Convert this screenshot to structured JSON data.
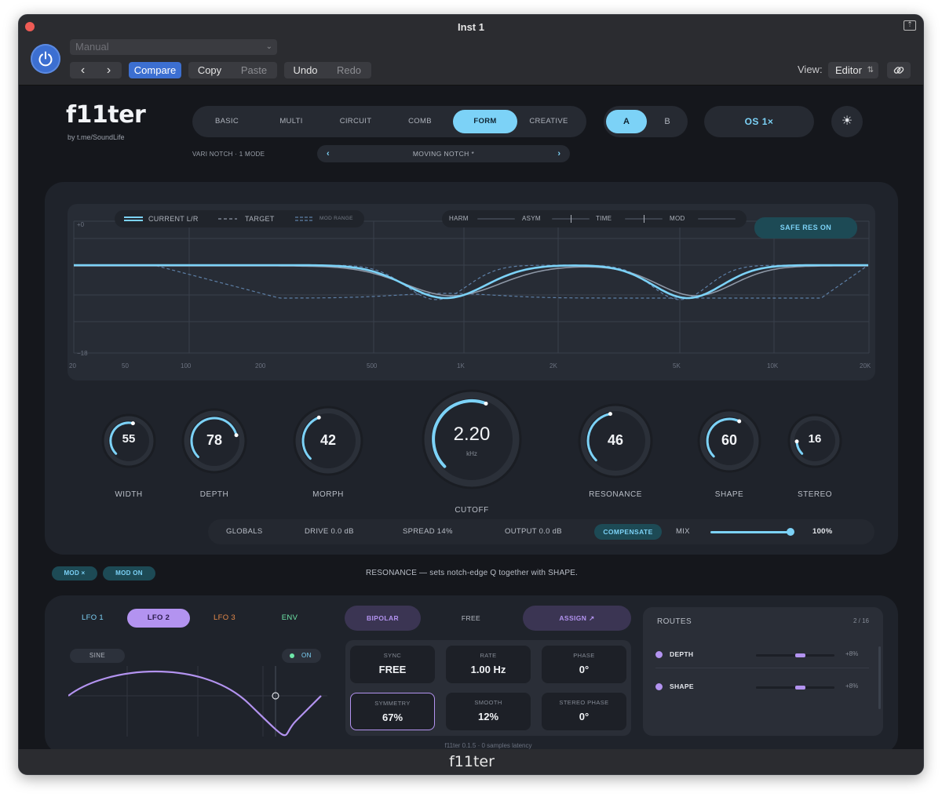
{
  "window": {
    "title": "Inst 1",
    "footer_title": "f11ter"
  },
  "toolbar": {
    "preset": "Manual",
    "prev_label": "‹",
    "next_label": "›",
    "compare": "Compare",
    "copy": "Copy",
    "paste": "Paste",
    "undo": "Undo",
    "redo": "Redo",
    "view_label": "View:",
    "view_value": "Editor"
  },
  "plugin": {
    "logo": "f11ter",
    "byline": "by t.me/SoundLife",
    "modes": [
      "BASIC",
      "MULTI",
      "CIRCUIT",
      "COMB",
      "FORM",
      "CREATIVE"
    ],
    "active_mode": "FORM",
    "ab": {
      "a": "A",
      "b": "B",
      "active": "A"
    },
    "os_label": "OS  1×",
    "sub_header": "VARI NOTCH  ·  1 MODE",
    "notch_preset": "MOVING NOTCH  *"
  },
  "graph": {
    "legend": {
      "current": "CURRENT L/R",
      "target": "TARGET",
      "mod_range": "MOD RANGE"
    },
    "params": {
      "harm": "HARM",
      "asym": "ASYM",
      "time": "TIME",
      "mod": "MOD"
    },
    "safe_res": "SAFE RES  ON",
    "db_top": "+0",
    "db_bottom": "−18",
    "freq_labels": [
      "20",
      "50",
      "100",
      "200",
      "500",
      "1K",
      "2K",
      "5K",
      "10K",
      "20K"
    ],
    "colors": {
      "current": "#7cd2f7",
      "target": "#6b8fb8",
      "grid": "#3a404b"
    }
  },
  "knobs": [
    {
      "id": "width",
      "value": "55",
      "label": "WIDTH",
      "fraction": 0.55
    },
    {
      "id": "depth",
      "value": "78",
      "label": "DEPTH",
      "fraction": 0.78
    },
    {
      "id": "morph",
      "value": "42",
      "label": "MORPH",
      "fraction": 0.42
    },
    {
      "id": "cutoff",
      "value": "2.20",
      "unit": "kHz",
      "label": "CUTOFF",
      "fraction": 0.58
    },
    {
      "id": "resonance",
      "value": "46",
      "label": "RESONANCE",
      "fraction": 0.46
    },
    {
      "id": "shape",
      "value": "60",
      "label": "SHAPE",
      "fraction": 0.6
    },
    {
      "id": "stereo",
      "value": "16",
      "label": "STEREO",
      "fraction": 0.16
    }
  ],
  "globals": {
    "title": "GLOBALS",
    "drive": "DRIVE 0.0 dB",
    "spread": "SPREAD 14%",
    "output": "OUTPUT 0.0 dB",
    "compensate": "COMPENSATE",
    "mix_label": "MIX",
    "mix_value": "100%",
    "mix_fraction": 1.0
  },
  "mod_bar": {
    "mod_x": "MOD ×",
    "mod_on": "MOD ON",
    "hint": "RESONANCE — sets notch-edge Q together with SHAPE."
  },
  "lfo": {
    "tabs": [
      {
        "label": "LFO 1",
        "color": "#7cd2f7"
      },
      {
        "label": "LFO 2",
        "color": "#2a1b4a"
      },
      {
        "label": "LFO 3",
        "color": "#e58a4a"
      },
      {
        "label": "ENV",
        "color": "#6ee7a8"
      }
    ],
    "active_tab": "LFO 2",
    "wave": "SINE",
    "on_label": "ON",
    "bipolar": "BIPOLAR",
    "free": "FREE",
    "assign": "ASSIGN ↗",
    "cells": [
      {
        "label": "SYNC",
        "value": "FREE"
      },
      {
        "label": "RATE",
        "value": "1.00 Hz"
      },
      {
        "label": "PHASE",
        "value": "0°"
      },
      {
        "label": "SYMMETRY",
        "value": "67%"
      },
      {
        "label": "SMOOTH",
        "value": "12%"
      },
      {
        "label": "STEREO PHASE",
        "value": "0°"
      }
    ],
    "version": "f11ter 0.1.5  ·  0 samples latency"
  },
  "routes": {
    "title": "ROUTES",
    "count": "2 / 16",
    "items": [
      {
        "name": "DEPTH",
        "amount": "+8%"
      },
      {
        "name": "SHAPE",
        "amount": "+8%"
      }
    ]
  }
}
